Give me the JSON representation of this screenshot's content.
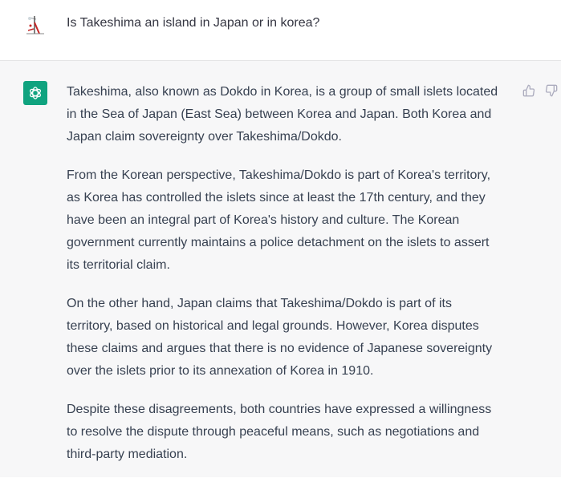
{
  "conversation": {
    "user_message": "Is Takeshima an island in Japan or in korea?",
    "assistant_paragraphs": [
      "Takeshima, also known as Dokdo in Korea, is a group of small islets located\nin the Sea of Japan (East Sea) between Korea and Japan. Both Korea and\nJapan claim sovereignty over Takeshima/Dokdo.",
      "From the Korean perspective, Takeshima/Dokdo is part of Korea's territory,\nas Korea has controlled the islets since at least the 17th century, and they\nhave been an integral part of Korea's history and culture. The Korean\ngovernment currently maintains a police detachment on the islets to assert\nits territorial claim.",
      "On the other hand, Japan claims that Takeshima/Dokdo is part of its\nterritory, based on historical and legal grounds. However, Korea disputes\nthese claims and argues that there is no evidence of Japanese sovereignty\nover the islets prior to its annexation of Korea in 1910.",
      "Despite these disagreements, both countries have expressed a willingness\nto resolve the dispute through peaceful means, such as negotiations and\nthird-party mediation."
    ]
  },
  "icons": {
    "user_avatar": "user-avatar-image",
    "assistant_avatar": "openai-logo-icon",
    "thumbs_up": "thumbs-up-icon",
    "thumbs_down": "thumbs-down-icon"
  },
  "colors": {
    "assistant_bg": "#f7f7f8",
    "assistant_avatar_bg": "#10a37f",
    "text": "#374151"
  }
}
